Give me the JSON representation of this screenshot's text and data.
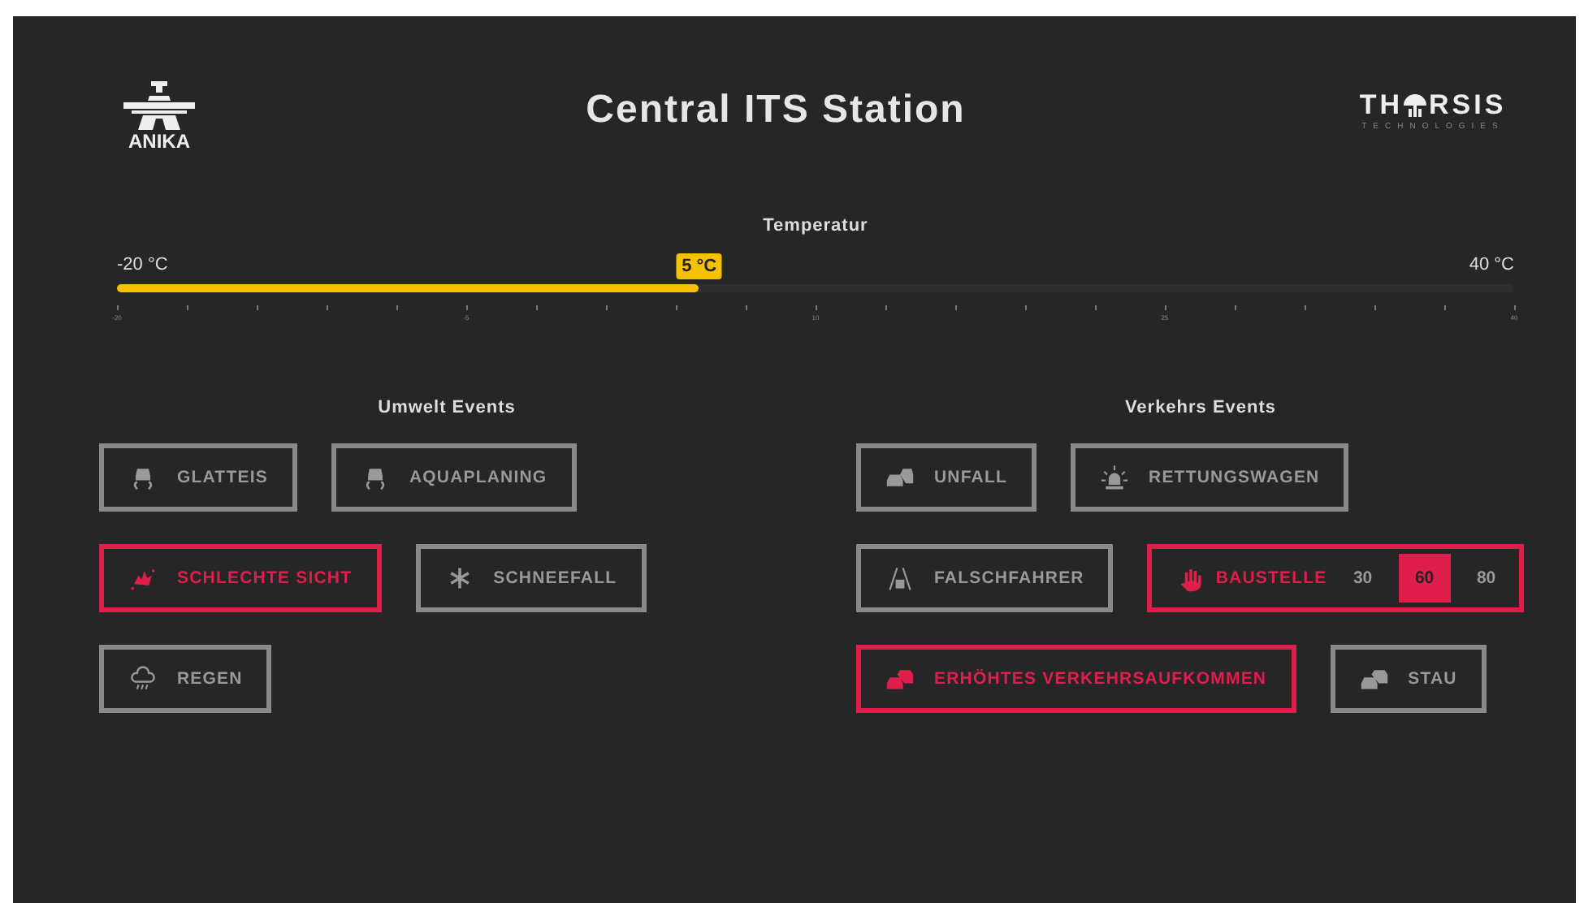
{
  "header": {
    "logo_left": "ANIKA",
    "title": "Central ITS Station",
    "logo_right": {
      "left": "TH",
      "right": "RSIS",
      "tagline": "TECHNOLOGIES"
    }
  },
  "temperature": {
    "label": "Temperatur",
    "min": "-20 °C",
    "max": "40 °C",
    "reading": "5 °C",
    "level": 0.4167,
    "tick_labels": [
      "-20",
      "-5",
      "10",
      "25",
      "40"
    ]
  },
  "groups": [
    {
      "title": "Umwelt Events",
      "rows": [
        [
          {
            "kind": "plain",
            "label": "GLATTEIS",
            "active": false
          },
          {
            "kind": "plain",
            "label": "AQUAPLANING",
            "active": false
          }
        ],
        [
          {
            "kind": "plain",
            "label": "SCHLECHTE SICHT",
            "active": true
          },
          {
            "kind": "plain",
            "label": "SCHNEEFALL",
            "active": false
          }
        ],
        [
          {
            "kind": "plain",
            "label": "REGEN",
            "active": false
          }
        ]
      ]
    },
    {
      "title": "Verkehrs Events",
      "rows": [
        [
          {
            "kind": "plain",
            "label": "UNFALL",
            "active": false
          },
          {
            "kind": "plain",
            "label": "RETTUNGSWAGEN",
            "active": false
          }
        ],
        [
          {
            "kind": "plain",
            "label": "FALSCHFAHRER",
            "active": false
          },
          {
            "kind": "speed",
            "label": "BAUSTELLE",
            "active": true,
            "options": [
              {
                "label": "30",
                "selected": false
              },
              {
                "label": "60",
                "selected": true
              },
              {
                "label": "80",
                "selected": false
              }
            ]
          }
        ],
        [
          {
            "kind": "plain",
            "label": "ERHÖHTES VERKEHRSAUFKOMMEN",
            "active": true
          },
          {
            "kind": "plain",
            "label": "STAU",
            "active": false
          }
        ]
      ]
    }
  ]
}
